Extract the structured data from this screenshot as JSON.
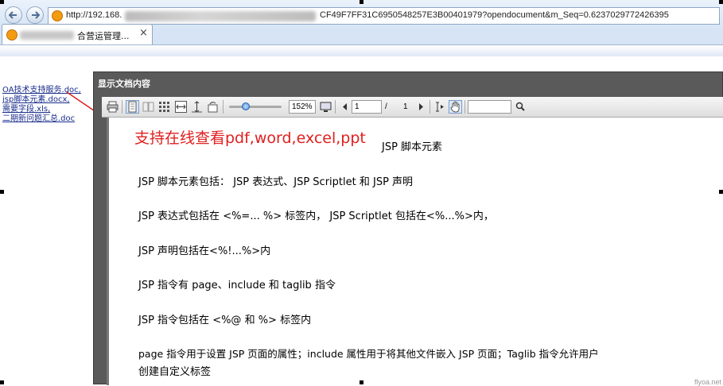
{
  "browser": {
    "url_prefix": "http://192.168.",
    "url_suffix": "CF49F7FF31C6950548257E3B00401979?opendocument&m_Seq=0.6237029772426395",
    "tab_title": "合营运管理...",
    "tab_close": "×"
  },
  "side_links": [
    "OA技术支持服务.doc,",
    "jsp脚本元素.docx,",
    "需要字段.xls,",
    "二期新问题汇总.doc"
  ],
  "dialog": {
    "title": "显示文档内容"
  },
  "toolbar": {
    "zoom": "152%",
    "page_current": "1",
    "page_separator": "/",
    "page_total": "1",
    "search_value": ""
  },
  "document": {
    "annotation": "支持在线查看pdf,word,excel,ppt",
    "title": "JSP  脚本元素",
    "lines": [
      "JSP  脚本元素包括：  JSP  表达式、JSP Scriptlet  和  JSP  声明",
      "JSP  表达式包括在  <%=... %>  标签内，   JSP Scriptlet  包括在<%...%>内，",
      "JSP 声明包括在<%!...%>内",
      "JSP  指令有  page、include  和  taglib 指令",
      "JSP  指令包括在  <%@  和  %>  标签内",
      "page  指令用于设置  JSP  页面的属性；include  属性用于将其他文件嵌入  JSP  页面；Taglib  指令允许用户",
      "创建自定义标签"
    ],
    "watermark": "flyoa.net"
  },
  "colors": {
    "annotation": "#e02020",
    "dialog_bg": "#5a5a5a",
    "link": "#1a2d8c"
  }
}
